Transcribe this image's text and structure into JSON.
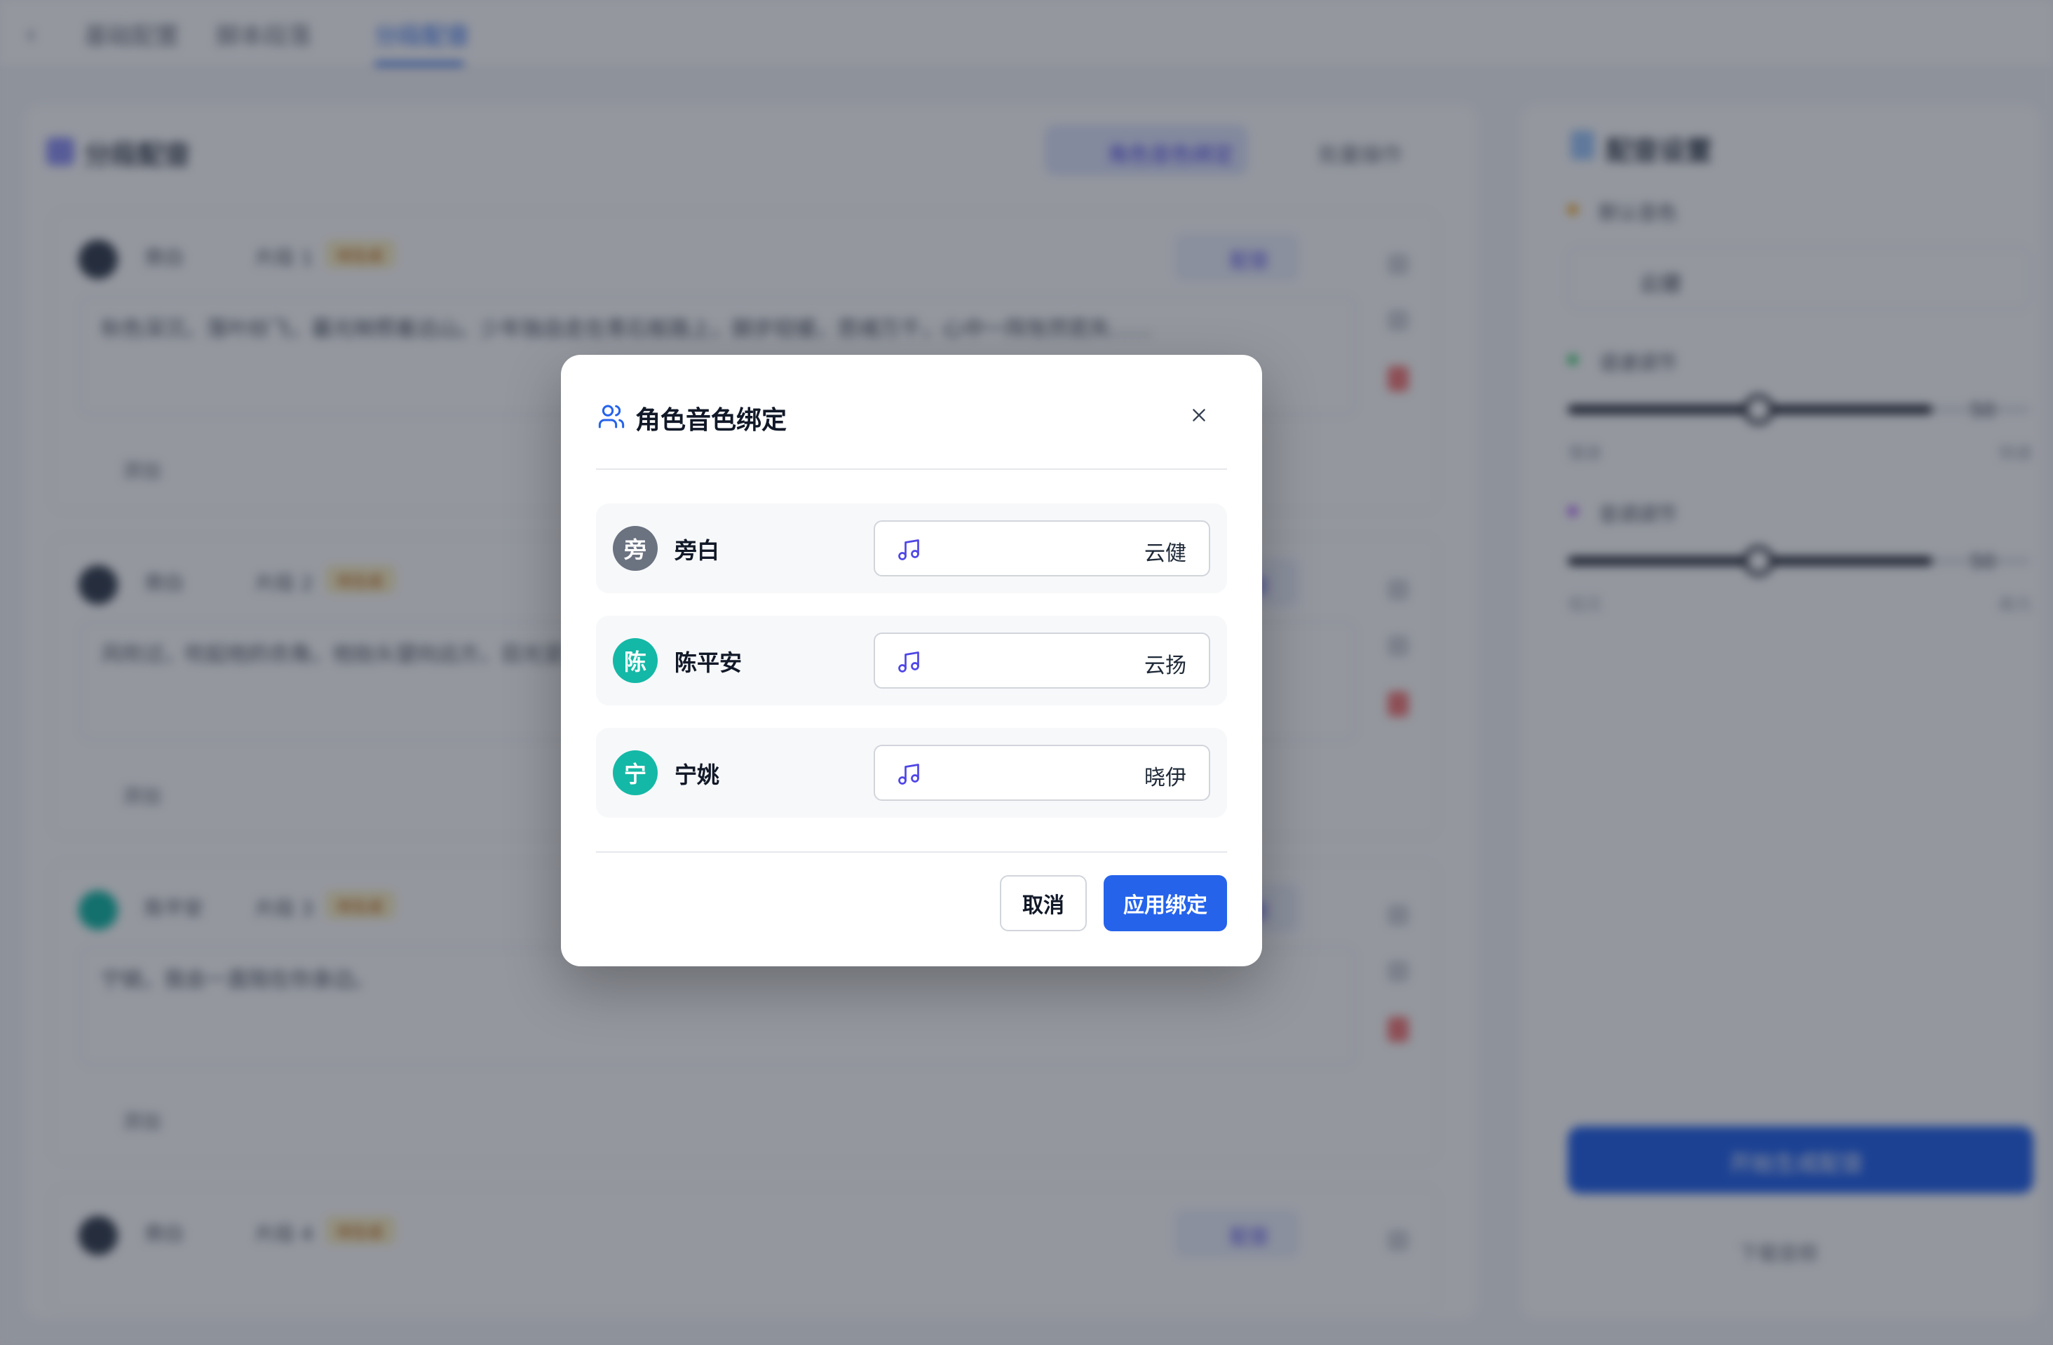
{
  "background": {
    "tabs": [
      "基础配置",
      "脚本段落",
      "分段配音"
    ],
    "main": {
      "title": "分段配音",
      "bind_button": "角色音色绑定",
      "more_button": "批量操作"
    },
    "segments": [
      {
        "speaker": "旁白",
        "para": "片段 1",
        "badge": "待生成",
        "dub_label": "配音",
        "text": "秋色深沉，落叶纷飞，暮光映照着远山。少年独自走在青石板路上，脚步轻缓，思绪万千，心中一阵怅然若失……",
        "add_label": "添加"
      },
      {
        "speaker": "旁白",
        "para": "片段 2",
        "badge": "待生成",
        "dub_label": "配音",
        "text": "风吹过，吹起他的衣角，他抬头望向远方，目光坚定。",
        "add_label": "添加"
      },
      {
        "speaker": "陈平安",
        "para": "片段 3",
        "badge": "待生成",
        "dub_label": "配音",
        "text": "宁姚，我会一直陪在你身边。",
        "add_label": "添加"
      },
      {
        "speaker": "旁白",
        "para": "片段 4",
        "badge": "待生成",
        "dub_label": "配音",
        "text": "",
        "add_label": "添加"
      }
    ],
    "settings": {
      "title": "配音设置",
      "voice_label": "默认音色",
      "voice_value": "云健",
      "speed_label": "语速调节",
      "speed_value": "50",
      "speed_min": "慢速",
      "speed_max": "快速",
      "pitch_label": "音调调节",
      "pitch_value": "50",
      "pitch_min": "低沉",
      "pitch_max": "高亢",
      "start_button": "开始生成配音",
      "download_link": "下载音频"
    }
  },
  "modal": {
    "title": "角色音色绑定",
    "rows": [
      {
        "avatar": "旁",
        "name": "旁白",
        "voice": "云健",
        "color": "#6b7280"
      },
      {
        "avatar": "陈",
        "name": "陈平安",
        "voice": "云扬",
        "color": "#14b8a6"
      },
      {
        "avatar": "宁",
        "name": "宁姚",
        "voice": "晓伊",
        "color": "#14b8a6"
      }
    ],
    "cancel_label": "取消",
    "apply_label": "应用绑定"
  },
  "colors": {
    "accent": "#2563eb",
    "avatar_gray": "#6b7280",
    "avatar_teal": "#14b8a6",
    "note_icon": "#4f46e5"
  },
  "icons": {
    "title": "users-icon",
    "close": "close-icon",
    "voice": "music-note-icon"
  }
}
